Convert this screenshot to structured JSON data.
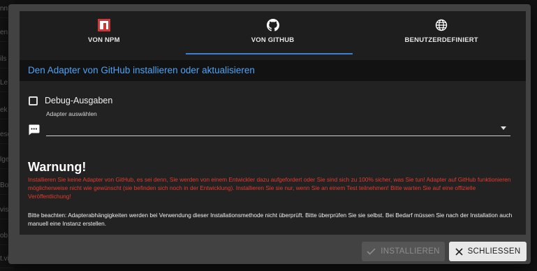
{
  "background_rows": [
    "nn",
    "en",
    "ils",
    "Le",
    "ek",
    "esc",
    "lge",
    "Bo",
    "vis",
    "ob",
    "t.vi"
  ],
  "tabs": [
    {
      "label": "VON NPM",
      "icon": "npm-icon"
    },
    {
      "label": "VON GITHUB",
      "icon": "github-icon"
    },
    {
      "label": "BENUTZERDEFINIERT",
      "icon": "globe-icon"
    }
  ],
  "active_tab": "VON GITHUB",
  "header": {
    "title": "Den Adapter von GitHub installieren oder aktualisieren"
  },
  "form": {
    "debug_label": "Debug-Ausgaben",
    "debug_checked": false,
    "select_label": "Adapter auswählen",
    "select_value": ""
  },
  "warning": {
    "title": "Warnung!",
    "text": "Installieren Sie keine Adapter von GitHub, es sei denn, Sie werden von einem Entwickler dazu aufgefordert oder Sie sind sich zu 100% sicher, was Sie tun! Adapter auf GitHub funktionieren möglicherweise nicht wie gewünscht (sie befinden sich noch in der Entwicklung). Installieren Sie sie nur, wenn Sie an einem Test teilnehmen! Bitte warten Sie auf eine offizielle Veröffentlichung!",
    "note": "Bitte beachten: Adapterabhängigkeiten werden bei Verwendung dieser Installationsmethode nicht überprüft. Bitte überprüfen Sie sie selbst. Bei Bedarf müssen Sie nach der Installation auch manuell eine Instanz erstellen."
  },
  "buttons": {
    "install_label": "INSTALLIEREN",
    "close_label": "SCHLIESSEN"
  },
  "colors": {
    "accent": "#3f7fd0",
    "header_text": "#4ea3f5",
    "warning_text": "#e23b2e",
    "npm_red": "#cb3837"
  }
}
